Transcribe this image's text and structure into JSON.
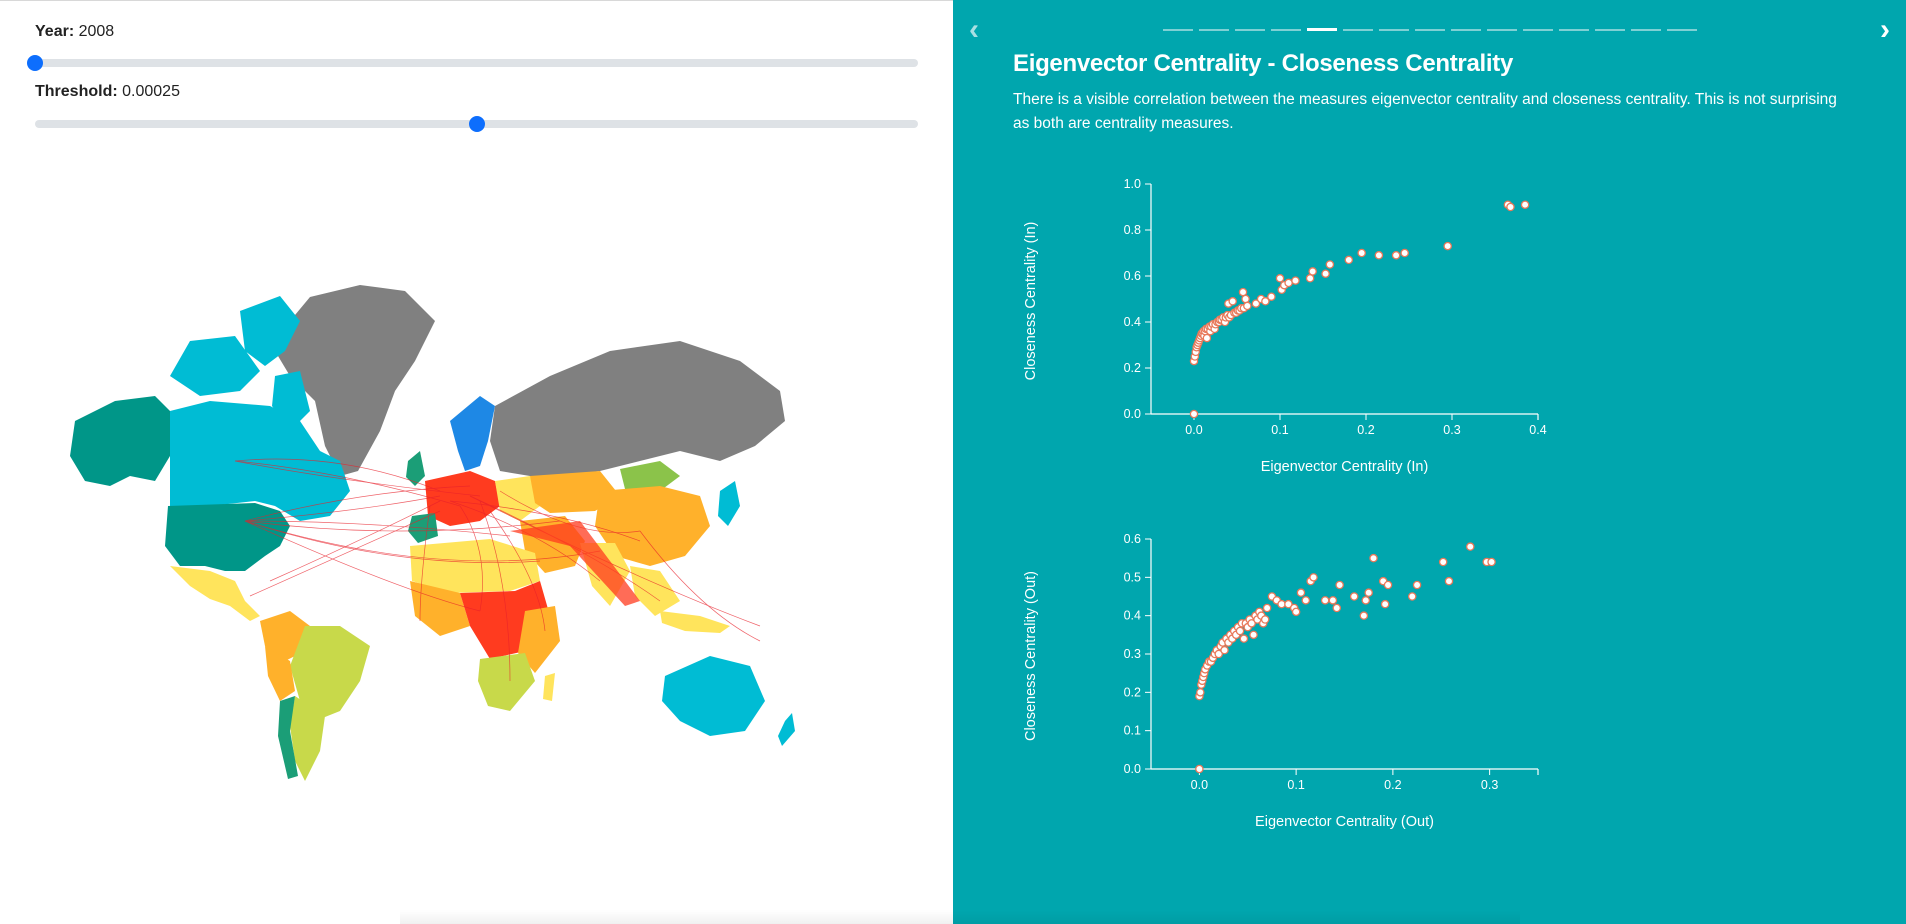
{
  "controls": {
    "year_label": "Year:",
    "year_value": "2008",
    "year_fraction": 0.0,
    "threshold_label": "Threshold:",
    "threshold_value": "0.00025",
    "threshold_fraction": 0.5
  },
  "map": {
    "description_colors": {
      "high_green": "#1b9e77",
      "teal": "#009688",
      "cyan": "#00bcd4",
      "gray": "#808080",
      "yellow": "#ffe45c",
      "orange": "#ffb12b",
      "red": "#ff3b1f",
      "lime": "#c8d94a",
      "trade_line": "#e8202a"
    }
  },
  "slides": {
    "count": 15,
    "active_index": 4,
    "prev_icon": "chevron-left-icon",
    "next_icon": "chevron-right-icon"
  },
  "slide": {
    "title": "Eigenvector Centrality - Closeness Centrality",
    "description": "There is a visible correlation between the measures eigenvector centrality and closeness centrality. This is not surprising as both are centrality measures."
  },
  "chart_data": [
    {
      "type": "scatter",
      "xlabel": "Eigenvector Centrality (In)",
      "ylabel": "Closeness Centrality (In)",
      "xlim": [
        -0.05,
        0.4
      ],
      "ylim": [
        0.0,
        1.0
      ],
      "xticks": [
        "0.0",
        "0.1",
        "0.2",
        "0.3",
        "0.4"
      ],
      "yticks": [
        "0.0",
        "0.2",
        "0.4",
        "0.6",
        "0.8",
        "1.0"
      ],
      "points": [
        [
          0.0,
          0.0
        ],
        [
          0.0,
          0.23
        ],
        [
          0.001,
          0.25
        ],
        [
          0.002,
          0.27
        ],
        [
          0.003,
          0.29
        ],
        [
          0.004,
          0.3
        ],
        [
          0.005,
          0.31
        ],
        [
          0.006,
          0.32
        ],
        [
          0.007,
          0.33
        ],
        [
          0.008,
          0.34
        ],
        [
          0.009,
          0.35
        ],
        [
          0.01,
          0.35
        ],
        [
          0.011,
          0.36
        ],
        [
          0.012,
          0.34
        ],
        [
          0.013,
          0.36
        ],
        [
          0.014,
          0.37
        ],
        [
          0.015,
          0.33
        ],
        [
          0.016,
          0.37
        ],
        [
          0.018,
          0.38
        ],
        [
          0.019,
          0.36
        ],
        [
          0.02,
          0.38
        ],
        [
          0.022,
          0.39
        ],
        [
          0.024,
          0.37
        ],
        [
          0.025,
          0.39
        ],
        [
          0.027,
          0.4
        ],
        [
          0.029,
          0.4
        ],
        [
          0.03,
          0.41
        ],
        [
          0.032,
          0.41
        ],
        [
          0.034,
          0.42
        ],
        [
          0.036,
          0.4
        ],
        [
          0.037,
          0.42
        ],
        [
          0.039,
          0.43
        ],
        [
          0.04,
          0.48
        ],
        [
          0.041,
          0.42
        ],
        [
          0.043,
          0.43
        ],
        [
          0.045,
          0.49
        ],
        [
          0.047,
          0.44
        ],
        [
          0.049,
          0.44
        ],
        [
          0.051,
          0.45
        ],
        [
          0.053,
          0.45
        ],
        [
          0.055,
          0.46
        ],
        [
          0.057,
          0.53
        ],
        [
          0.058,
          0.46
        ],
        [
          0.06,
          0.5
        ],
        [
          0.062,
          0.47
        ],
        [
          0.072,
          0.48
        ],
        [
          0.078,
          0.5
        ],
        [
          0.083,
          0.49
        ],
        [
          0.09,
          0.51
        ],
        [
          0.1,
          0.59
        ],
        [
          0.102,
          0.54
        ],
        [
          0.105,
          0.56
        ],
        [
          0.11,
          0.57
        ],
        [
          0.118,
          0.58
        ],
        [
          0.135,
          0.59
        ],
        [
          0.138,
          0.62
        ],
        [
          0.153,
          0.61
        ],
        [
          0.158,
          0.65
        ],
        [
          0.18,
          0.67
        ],
        [
          0.195,
          0.7
        ],
        [
          0.215,
          0.69
        ],
        [
          0.235,
          0.69
        ],
        [
          0.245,
          0.7
        ],
        [
          0.295,
          0.73
        ],
        [
          0.365,
          0.91
        ],
        [
          0.368,
          0.9
        ],
        [
          0.385,
          0.91
        ]
      ]
    },
    {
      "type": "scatter",
      "xlabel": "Eigenvector Centrality (Out)",
      "ylabel": "Closeness Centrality (Out)",
      "xlim": [
        -0.05,
        0.35
      ],
      "ylim": [
        0.0,
        0.6
      ],
      "xticks": [
        "0.0",
        "0.1",
        "0.2",
        "0.3"
      ],
      "yticks": [
        "0.0",
        "0.1",
        "0.2",
        "0.3",
        "0.4",
        "0.5",
        "0.6"
      ],
      "points": [
        [
          0.0,
          0.0
        ],
        [
          0.0,
          0.19
        ],
        [
          0.001,
          0.2
        ],
        [
          0.002,
          0.22
        ],
        [
          0.003,
          0.23
        ],
        [
          0.004,
          0.24
        ],
        [
          0.005,
          0.25
        ],
        [
          0.006,
          0.26
        ],
        [
          0.008,
          0.27
        ],
        [
          0.01,
          0.28
        ],
        [
          0.012,
          0.28
        ],
        [
          0.014,
          0.29
        ],
        [
          0.016,
          0.3
        ],
        [
          0.018,
          0.31
        ],
        [
          0.02,
          0.3
        ],
        [
          0.022,
          0.32
        ],
        [
          0.024,
          0.33
        ],
        [
          0.026,
          0.31
        ],
        [
          0.028,
          0.34
        ],
        [
          0.03,
          0.33
        ],
        [
          0.032,
          0.35
        ],
        [
          0.034,
          0.34
        ],
        [
          0.036,
          0.36
        ],
        [
          0.038,
          0.35
        ],
        [
          0.04,
          0.37
        ],
        [
          0.042,
          0.36
        ],
        [
          0.044,
          0.38
        ],
        [
          0.046,
          0.34
        ],
        [
          0.048,
          0.38
        ],
        [
          0.05,
          0.37
        ],
        [
          0.052,
          0.39
        ],
        [
          0.054,
          0.38
        ],
        [
          0.056,
          0.35
        ],
        [
          0.058,
          0.4
        ],
        [
          0.06,
          0.39
        ],
        [
          0.062,
          0.41
        ],
        [
          0.064,
          0.4
        ],
        [
          0.066,
          0.38
        ],
        [
          0.068,
          0.39
        ],
        [
          0.07,
          0.42
        ],
        [
          0.075,
          0.45
        ],
        [
          0.08,
          0.44
        ],
        [
          0.085,
          0.43
        ],
        [
          0.092,
          0.43
        ],
        [
          0.098,
          0.42
        ],
        [
          0.1,
          0.41
        ],
        [
          0.105,
          0.46
        ],
        [
          0.11,
          0.44
        ],
        [
          0.115,
          0.49
        ],
        [
          0.118,
          0.5
        ],
        [
          0.13,
          0.44
        ],
        [
          0.138,
          0.44
        ],
        [
          0.142,
          0.42
        ],
        [
          0.145,
          0.48
        ],
        [
          0.16,
          0.45
        ],
        [
          0.17,
          0.4
        ],
        [
          0.172,
          0.44
        ],
        [
          0.175,
          0.46
        ],
        [
          0.18,
          0.55
        ],
        [
          0.19,
          0.49
        ],
        [
          0.192,
          0.43
        ],
        [
          0.195,
          0.48
        ],
        [
          0.22,
          0.45
        ],
        [
          0.225,
          0.48
        ],
        [
          0.252,
          0.54
        ],
        [
          0.258,
          0.49
        ],
        [
          0.28,
          0.58
        ],
        [
          0.297,
          0.54
        ],
        [
          0.302,
          0.54
        ]
      ]
    }
  ]
}
